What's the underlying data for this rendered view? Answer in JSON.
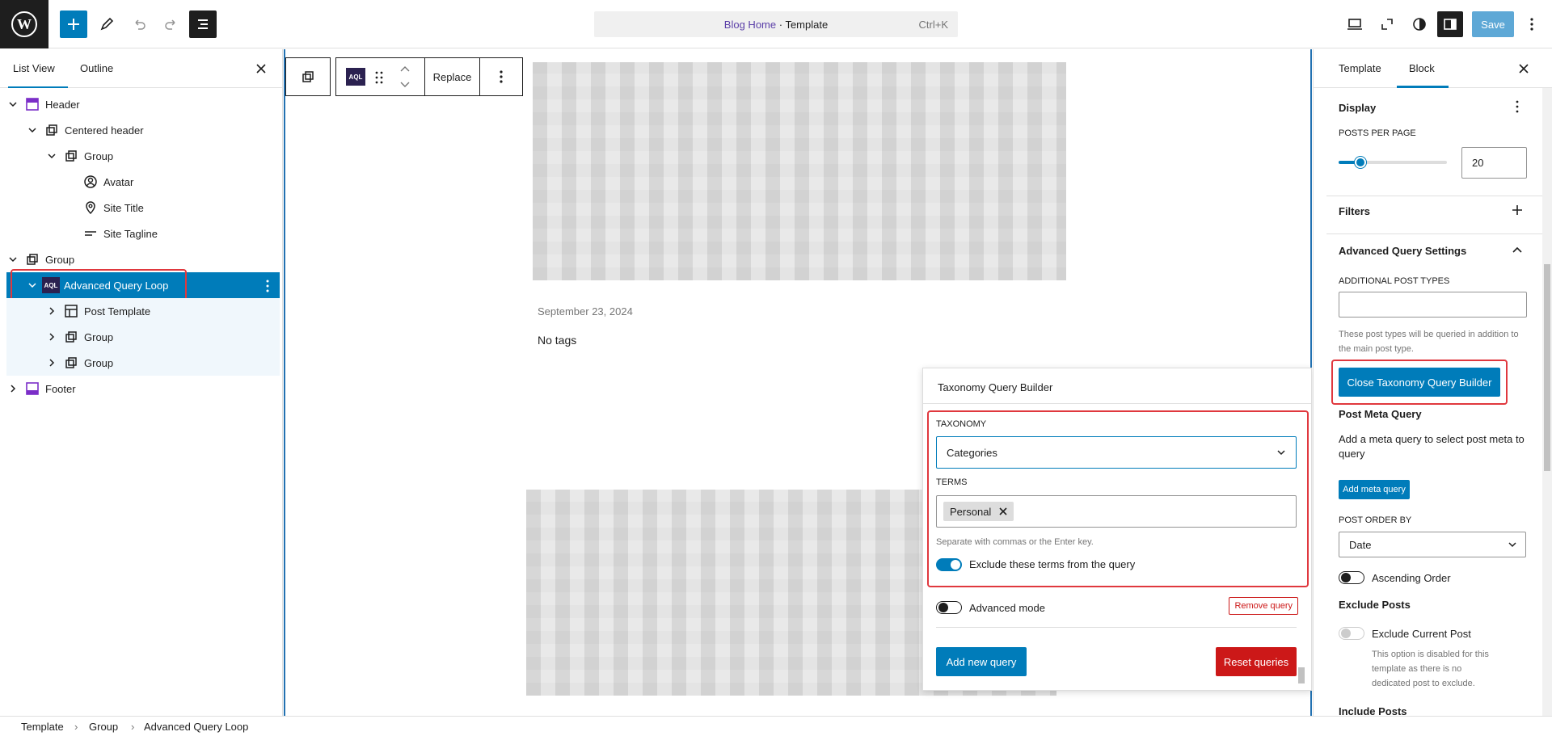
{
  "topbar": {
    "command_title": "Blog Home",
    "command_suffix": "· Template",
    "shortcut": "Ctrl+K",
    "save_label": "Save"
  },
  "left_panel": {
    "tabs": [
      "List View",
      "Outline"
    ],
    "items": [
      {
        "label": "Header"
      },
      {
        "label": "Centered header"
      },
      {
        "label": "Group"
      },
      {
        "label": "Avatar"
      },
      {
        "label": "Site Title"
      },
      {
        "label": "Site Tagline"
      },
      {
        "label": "Group"
      },
      {
        "label": "Advanced Query Loop"
      },
      {
        "label": "Post Template"
      },
      {
        "label": "Group"
      },
      {
        "label": "Group"
      },
      {
        "label": "Footer"
      }
    ]
  },
  "canvas": {
    "block_badge": "AQL",
    "replace_label": "Replace",
    "post_date": "September 23, 2024",
    "post_tags": "No tags"
  },
  "popover": {
    "title": "Taxonomy Query Builder",
    "taxonomy_label": "TAXONOMY",
    "taxonomy_value": "Categories",
    "terms_label": "TERMS",
    "term_token": "Personal",
    "terms_help": "Separate with commas or the Enter key.",
    "exclude_label": "Exclude these terms from the query",
    "exclude_on": true,
    "advanced_label": "Advanced mode",
    "advanced_on": false,
    "remove_label": "Remove query",
    "add_label": "Add new query",
    "reset_label": "Reset queries"
  },
  "right_panel": {
    "tabs": [
      "Template",
      "Block"
    ],
    "display_title": "Display",
    "posts_per_page_label": "POSTS PER PAGE",
    "posts_per_page_value": "20",
    "posts_per_page_slider": 0.2,
    "filters_label": "Filters",
    "aqs_title": "Advanced Query Settings",
    "additional_types_label": "ADDITIONAL POST TYPES",
    "additional_types_help": "These post types will be queried in addition to the main post type.",
    "close_builder_label": "Close Taxonomy Query Builder",
    "meta_title": "Post Meta Query",
    "meta_help": "Add a meta query to select post meta to query",
    "add_meta_label": "Add meta query",
    "order_by_label": "POST ORDER BY",
    "order_by_value": "Date",
    "ascending_label": "Ascending Order",
    "exclude_posts_title": "Exclude Posts",
    "exclude_current_label": "Exclude Current Post",
    "exclude_current_help": "This option is disabled for this template as there is no dedicated post to exclude.",
    "include_posts_title": "Include Posts"
  },
  "breadcrumb": [
    "Template",
    "Group",
    "Advanced Query Loop"
  ],
  "colors": {
    "accent": "#007cba",
    "highlight": "#e0383e",
    "danger": "#cc1818"
  }
}
